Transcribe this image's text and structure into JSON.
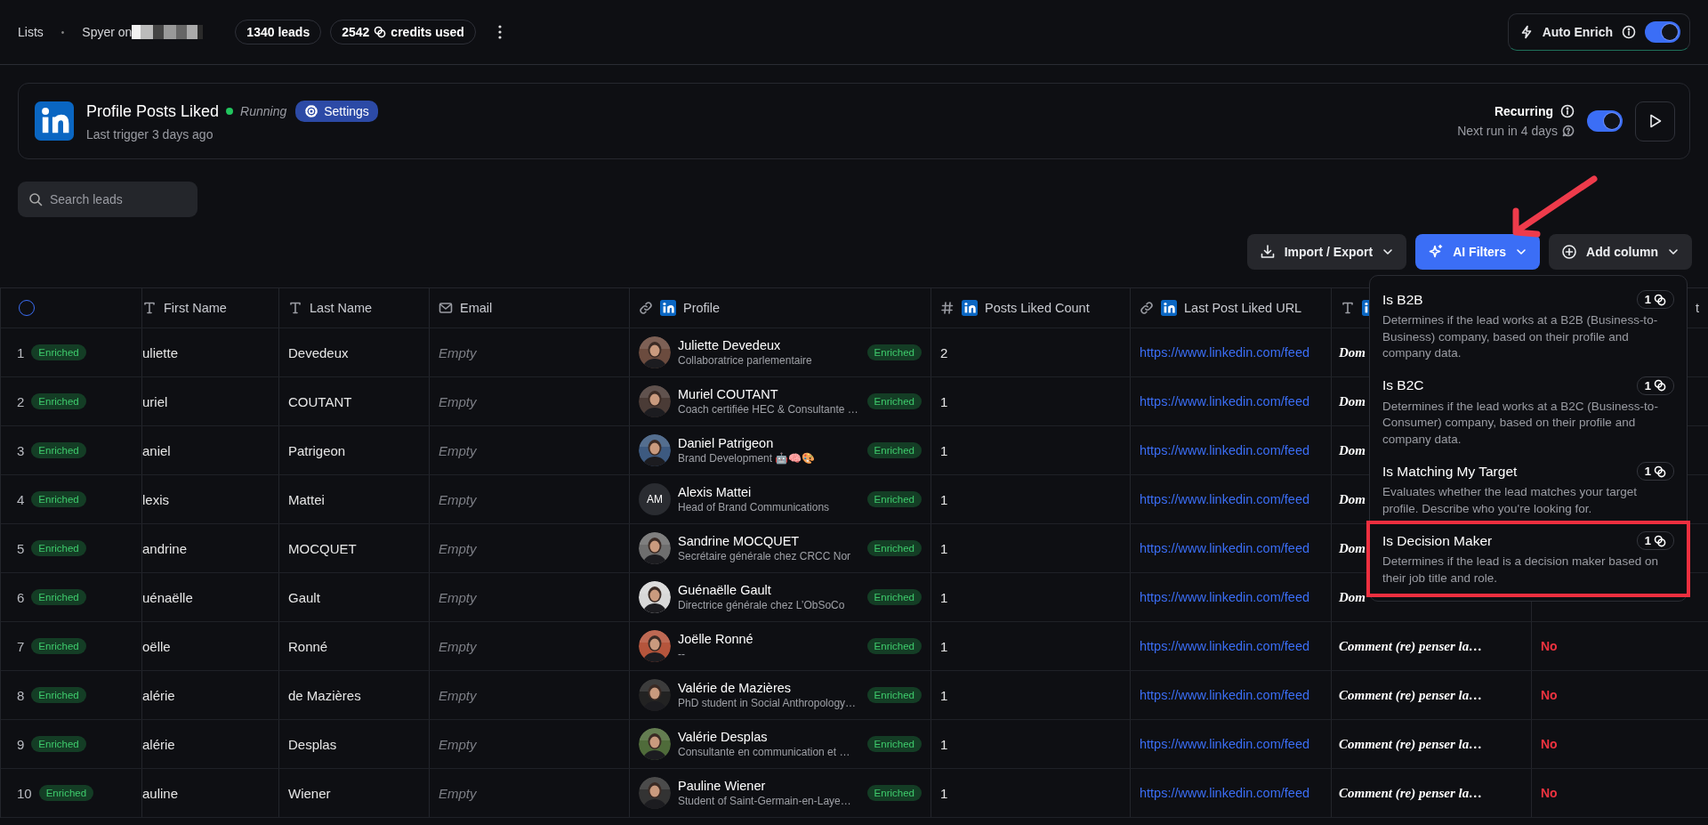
{
  "breadcrumb": {
    "root": "Lists",
    "separator": "•",
    "list_name": "Spyer on"
  },
  "leads_badge": "1340 leads",
  "credits_badge": {
    "count": "2542",
    "label": "credits used"
  },
  "auto_enrich": {
    "label": "Auto Enrich",
    "on": true
  },
  "workflow": {
    "title": "Profile Posts Liked",
    "status": "Running",
    "settings_label": "Settings",
    "subtitle": "Last trigger 3 days ago",
    "recurring_label": "Recurring",
    "next_run": "Next run in 4 days",
    "recurring_on": true
  },
  "search": {
    "placeholder": "Search leads"
  },
  "actions": [
    {
      "label": "Import / Export",
      "kind": "download",
      "primary": false
    },
    {
      "label": "AI Filters",
      "kind": "sparkle",
      "primary": true
    },
    {
      "label": "Add column",
      "kind": "add",
      "primary": false
    }
  ],
  "ai_filters_menu": {
    "items": [
      {
        "title": "Is B2B",
        "cost": "1",
        "description": "Determines if the lead works at a B2B (Business-to-Business) company, based on their profile and company data.",
        "highlighted": false
      },
      {
        "title": "Is B2C",
        "cost": "1",
        "description": "Determines if the lead works at a B2C (Business-to-Consumer) company, based on their profile and company data.",
        "highlighted": false
      },
      {
        "title": "Is Matching My Target",
        "cost": "1",
        "description": "Evaluates whether the lead matches your target profile. Describe who you're looking for.",
        "highlighted": false
      },
      {
        "title": "Is Decision Maker",
        "cost": "1",
        "description": "Determines if the lead is a decision maker based on their job title and role.",
        "highlighted": true
      }
    ]
  },
  "table": {
    "select_all": {
      "checked": false
    },
    "columns": [
      {
        "label": "First Name",
        "kind": "text"
      },
      {
        "label": "Last Name",
        "kind": "text"
      },
      {
        "label": "Email",
        "kind": "email"
      },
      {
        "label": "Profile",
        "kind": "linkedin_link"
      },
      {
        "label": "Posts Liked Count",
        "kind": "linkedin_number"
      },
      {
        "label": "Last Post Liked URL",
        "kind": "linkedin_link"
      },
      {
        "kind": "linkedin_text"
      },
      {
        "label": "t",
        "kind": "plain"
      }
    ],
    "rows": [
      {
        "number": "1",
        "status": "Enriched",
        "first_name": "uliette",
        "last_name": "Devedeux",
        "email": "Empty",
        "profile": {
          "name": "Juliette Devedeux",
          "headline": "Collaboratrice parlementaire",
          "status": "Enriched"
        },
        "posts_liked_count": "2",
        "last_post_liked_url": "https://www.linkedin.com/feed",
        "column_7": "Dom"
      },
      {
        "number": "2",
        "status": "Enriched",
        "first_name": "uriel",
        "last_name": "COUTANT",
        "email": "Empty",
        "profile": {
          "name": "Muriel COUTANT",
          "headline": "Coach certifiée HEC & Consultante …",
          "status": "Enriched"
        },
        "posts_liked_count": "1",
        "last_post_liked_url": "https://www.linkedin.com/feed",
        "column_7": "Dom"
      },
      {
        "number": "3",
        "status": "Enriched",
        "first_name": "aniel",
        "last_name": "Patrigeon",
        "email": "Empty",
        "profile": {
          "name": "Daniel Patrigeon",
          "headline": "Brand Development 🤖🧠🎨",
          "status": "Enriched"
        },
        "posts_liked_count": "1",
        "last_post_liked_url": "https://www.linkedin.com/feed",
        "column_7": "Dom"
      },
      {
        "number": "4",
        "status": "Enriched",
        "first_name": "lexis",
        "last_name": "Mattei",
        "email": "Empty",
        "profile": {
          "name": "Alexis Mattei",
          "headline": "Head of Brand Communications",
          "avatar": {
            "kind": "initials",
            "initials": "AM"
          },
          "status": "Enriched"
        },
        "posts_liked_count": "1",
        "last_post_liked_url": "https://www.linkedin.com/feed",
        "column_7": "Dom"
      },
      {
        "number": "5",
        "status": "Enriched",
        "first_name": "andrine",
        "last_name": "MOCQUET",
        "email": "Empty",
        "profile": {
          "name": "Sandrine MOCQUET",
          "headline": "Secrétaire générale chez CRCC Nor",
          "status": "Enriched"
        },
        "posts_liked_count": "1",
        "last_post_liked_url": "https://www.linkedin.com/feed",
        "column_7": "Dom"
      },
      {
        "number": "6",
        "status": "Enriched",
        "first_name": "uénaëlle",
        "last_name": "Gault",
        "email": "Empty",
        "profile": {
          "name": "Guénaëlle Gault",
          "headline": "Directrice générale chez L’ObSoCo",
          "status": "Enriched"
        },
        "posts_liked_count": "1",
        "last_post_liked_url": "https://www.linkedin.com/feed",
        "column_7": "Dom"
      },
      {
        "number": "7",
        "status": "Enriched",
        "first_name": "oëlle",
        "last_name": "Ronné",
        "email": "Empty",
        "profile": {
          "name": "Joëlle Ronné",
          "headline": "--",
          "status": "Enriched"
        },
        "posts_liked_count": "1",
        "last_post_liked_url": "https://www.linkedin.com/feed",
        "column_7": "Comment (re) penser la…",
        "column_8": "No"
      },
      {
        "number": "8",
        "status": "Enriched",
        "first_name": "alérie",
        "last_name": "de Mazières",
        "email": "Empty",
        "profile": {
          "name": "Valérie de Mazières",
          "headline": "PhD student in Social Anthropology…",
          "status": "Enriched"
        },
        "posts_liked_count": "1",
        "last_post_liked_url": "https://www.linkedin.com/feed",
        "column_7": "Comment (re) penser la…",
        "column_8": "No"
      },
      {
        "number": "9",
        "status": "Enriched",
        "first_name": "alérie",
        "last_name": "Desplas",
        "email": "Empty",
        "profile": {
          "name": "Valérie Desplas",
          "headline": "Consultante en communication et …",
          "status": "Enriched"
        },
        "posts_liked_count": "1",
        "last_post_liked_url": "https://www.linkedin.com/feed",
        "column_7": "Comment (re) penser la…",
        "column_8": "No"
      },
      {
        "number": "10",
        "status": "Enriched",
        "first_name": "auline",
        "last_name": "Wiener",
        "email": "Empty",
        "profile": {
          "name": "Pauline Wiener",
          "headline": "Student of Saint-Germain-en-Laye…",
          "status": "Enriched"
        },
        "posts_liked_count": "1",
        "last_post_liked_url": "https://www.linkedin.com/feed",
        "column_7": "Comment (re) penser la…",
        "column_8": "No"
      }
    ]
  }
}
